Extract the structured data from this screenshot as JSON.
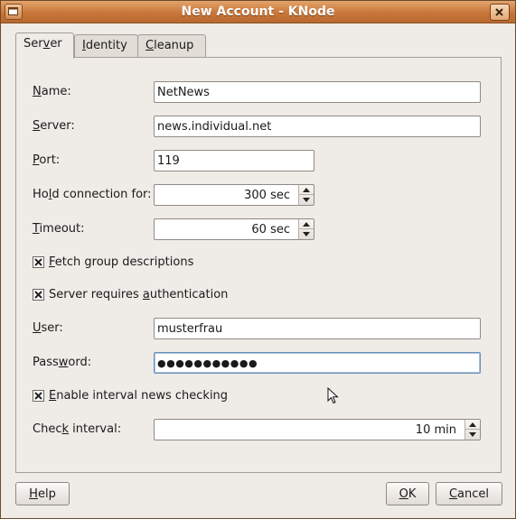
{
  "window": {
    "title": "New Account - KNode"
  },
  "tabs": [
    {
      "pre": "Ser",
      "key": "v",
      "post": "er"
    },
    {
      "pre": "",
      "key": "I",
      "post": "dentity"
    },
    {
      "pre": "",
      "key": "C",
      "post": "leanup"
    }
  ],
  "form": {
    "name_label": {
      "pre": "",
      "key": "N",
      "post": "ame:"
    },
    "name_value": "NetNews",
    "server_label": {
      "pre": "",
      "key": "S",
      "post": "erver:"
    },
    "server_value": "news.individual.net",
    "port_label": {
      "pre": "",
      "key": "P",
      "post": "ort:"
    },
    "port_value": "119",
    "hold_label": {
      "pre": "Ho",
      "key": "l",
      "post": "d connection for:"
    },
    "hold_value": "300 sec",
    "timeout_label": {
      "pre": "",
      "key": "T",
      "post": "imeout:"
    },
    "timeout_value": "60 sec",
    "fetch_label": {
      "pre": "",
      "key": "F",
      "post": "etch group descriptions"
    },
    "fetch_checked": true,
    "auth_label": {
      "pre": "Server requires ",
      "key": "a",
      "post": "uthentication"
    },
    "auth_checked": true,
    "user_label": {
      "pre": "",
      "key": "U",
      "post": "ser:"
    },
    "user_value": "musterfrau",
    "password_label": {
      "pre": "Pass",
      "key": "w",
      "post": "ord:"
    },
    "password_value": "●●●●●●●●●●●",
    "interval_label": {
      "pre": "",
      "key": "E",
      "post": "nable interval news checking"
    },
    "interval_checked": true,
    "check_interval_label": {
      "pre": "Chec",
      "key": "k",
      "post": " interval:"
    },
    "check_interval_value": "10 min"
  },
  "buttons": {
    "help": {
      "pre": "",
      "key": "H",
      "post": "elp"
    },
    "ok": {
      "pre": "",
      "key": "O",
      "post": "K"
    },
    "cancel": {
      "pre": "",
      "key": "C",
      "post": "ancel"
    }
  },
  "colors": {
    "titlebar": "#c9763a",
    "window_bg": "#efebe7",
    "focus_border": "#6d8fb6"
  },
  "icons": [
    "window-menu-icon",
    "close-icon",
    "spin-up-icon",
    "spin-down-icon",
    "check-icon",
    "mouse-cursor-icon"
  ]
}
